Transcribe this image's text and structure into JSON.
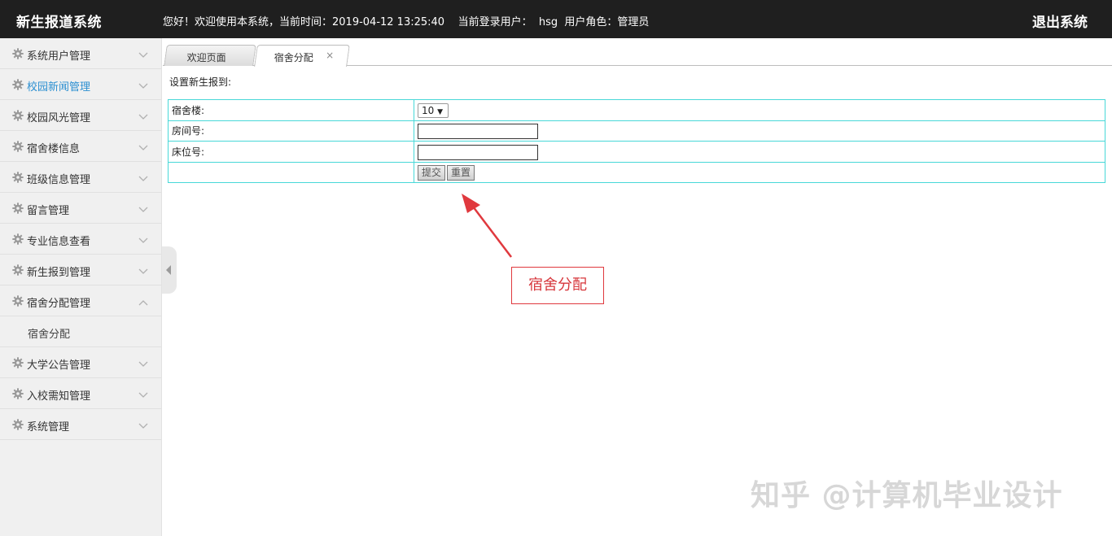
{
  "header": {
    "brand": "新生报道系统",
    "welcome": "您好！欢迎使用本系统，当前时间：2019-04-12 13:25:40    当前登录用户：  hsg  用户角色：管理员",
    "logout_label": "退出系统"
  },
  "sidebar": {
    "items": [
      {
        "label": "系统用户管理",
        "expanded": false,
        "active": false
      },
      {
        "label": "校园新闻管理",
        "expanded": false,
        "active": true
      },
      {
        "label": "校园风光管理",
        "expanded": false,
        "active": false
      },
      {
        "label": "宿舍楼信息",
        "expanded": false,
        "active": false
      },
      {
        "label": "班级信息管理",
        "expanded": false,
        "active": false
      },
      {
        "label": "留言管理",
        "expanded": false,
        "active": false
      },
      {
        "label": "专业信息查看",
        "expanded": false,
        "active": false
      },
      {
        "label": "新生报到管理",
        "expanded": false,
        "active": false
      },
      {
        "label": "宿舍分配管理",
        "expanded": true,
        "active": false
      },
      {
        "label": "大学公告管理",
        "expanded": false,
        "active": false
      },
      {
        "label": "入校需知管理",
        "expanded": false,
        "active": false
      },
      {
        "label": "系统管理",
        "expanded": false,
        "active": false
      }
    ],
    "subitem": {
      "label": "宿舍分配"
    }
  },
  "tabs": [
    {
      "label": "欢迎页面",
      "active": false
    },
    {
      "label": "宿舍分配",
      "active": true,
      "close": "×"
    }
  ],
  "form": {
    "section_title": "设置新生报到:",
    "building_label": "宿舍楼:",
    "building_value": "10",
    "room_label": "房间号:",
    "room_value": "",
    "bed_label": "床位号:",
    "bed_value": "",
    "submit_label": "提交",
    "reset_label": "重置"
  },
  "annotation": {
    "label": "宿舍分配",
    "color": "#e0393e"
  },
  "watermark": "知乎 @计算机毕业设计",
  "colors": {
    "topbar": "#1f1f1f",
    "active_menu": "#2b8fd1",
    "table_border": "#48d8d8"
  }
}
